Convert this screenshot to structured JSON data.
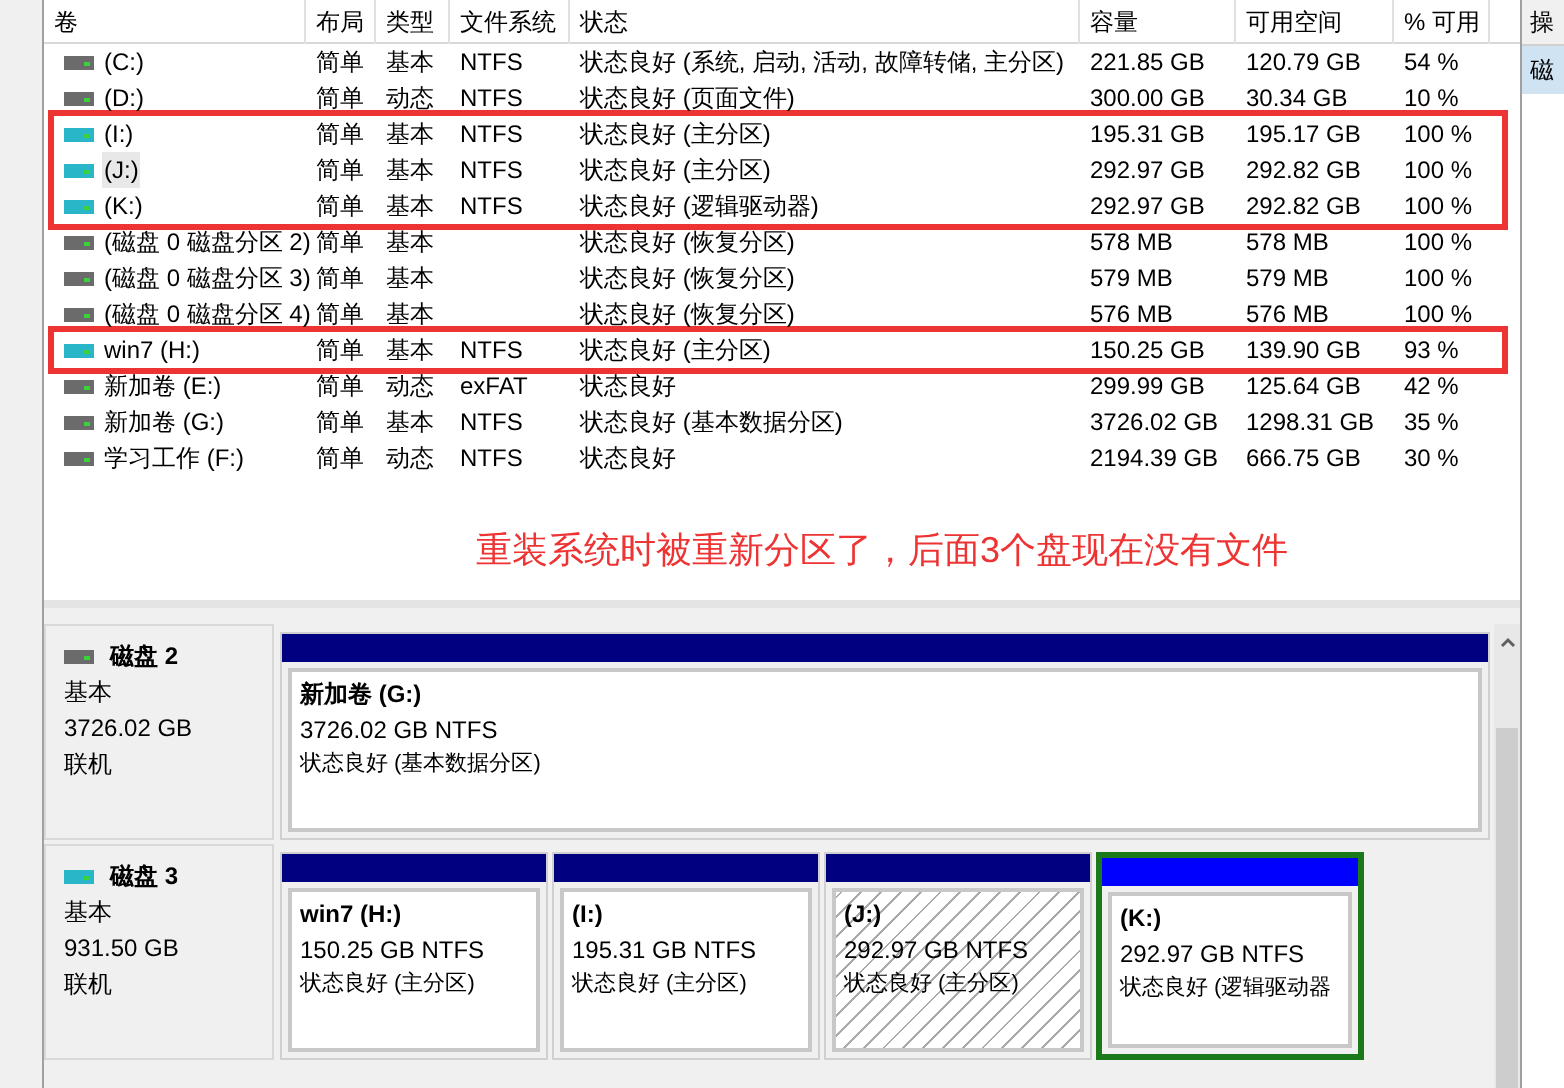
{
  "table": {
    "columns": [
      "卷",
      "布局",
      "类型",
      "文件系统",
      "状态",
      "容量",
      "可用空间",
      "% 可用"
    ],
    "rows": [
      {
        "cells": [
          "(C:)",
          "简单",
          "基本",
          "NTFS",
          "状态良好 (系统, 启动, 活动, 故障转储, 主分区)",
          "221.85 GB",
          "120.79 GB",
          "54 %"
        ],
        "color": "#6b6b6b",
        "highlighted": false,
        "selected": false
      },
      {
        "cells": [
          "(D:)",
          "简单",
          "动态",
          "NTFS",
          "状态良好 (页面文件)",
          "300.00 GB",
          "30.34 GB",
          "10 %"
        ],
        "color": "#6b6b6b",
        "highlighted": false,
        "selected": false
      },
      {
        "cells": [
          "(I:)",
          "简单",
          "基本",
          "NTFS",
          "状态良好 (主分区)",
          "195.31 GB",
          "195.17 GB",
          "100 %"
        ],
        "color": "#29b6c8",
        "highlighted": true,
        "selected": false
      },
      {
        "cells": [
          "(J:)",
          "简单",
          "基本",
          "NTFS",
          "状态良好 (主分区)",
          "292.97 GB",
          "292.82 GB",
          "100 %"
        ],
        "color": "#29b6c8",
        "highlighted": true,
        "selected": true
      },
      {
        "cells": [
          "(K:)",
          "简单",
          "基本",
          "NTFS",
          "状态良好 (逻辑驱动器)",
          "292.97 GB",
          "292.82 GB",
          "100 %"
        ],
        "color": "#29b6c8",
        "highlighted": true,
        "selected": false
      },
      {
        "cells": [
          "(磁盘 0 磁盘分区 2)",
          "简单",
          "基本",
          "",
          "状态良好 (恢复分区)",
          "578 MB",
          "578 MB",
          "100 %"
        ],
        "color": "#6b6b6b",
        "highlighted": false,
        "selected": false
      },
      {
        "cells": [
          "(磁盘 0 磁盘分区 3)",
          "简单",
          "基本",
          "",
          "状态良好 (恢复分区)",
          "579 MB",
          "579 MB",
          "100 %"
        ],
        "color": "#6b6b6b",
        "highlighted": false,
        "selected": false
      },
      {
        "cells": [
          "(磁盘 0 磁盘分区 4)",
          "简单",
          "基本",
          "",
          "状态良好 (恢复分区)",
          "576 MB",
          "576 MB",
          "100 %"
        ],
        "color": "#6b6b6b",
        "highlighted": false,
        "selected": false
      },
      {
        "cells": [
          "win7 (H:)",
          "简单",
          "基本",
          "NTFS",
          "状态良好 (主分区)",
          "150.25 GB",
          "139.90 GB",
          "93 %"
        ],
        "color": "#29b6c8",
        "highlighted": true,
        "selected": false
      },
      {
        "cells": [
          "新加卷 (E:)",
          "简单",
          "动态",
          "exFAT",
          "状态良好",
          "299.99 GB",
          "125.64 GB",
          "42 %"
        ],
        "color": "#6b6b6b",
        "highlighted": false,
        "selected": false
      },
      {
        "cells": [
          "新加卷 (G:)",
          "简单",
          "基本",
          "NTFS",
          "状态良好 (基本数据分区)",
          "3726.02 GB",
          "1298.31 GB",
          "35 %"
        ],
        "color": "#6b6b6b",
        "highlighted": false,
        "selected": false
      },
      {
        "cells": [
          "学习工作 (F:)",
          "简单",
          "动态",
          "NTFS",
          "状态良好",
          "2194.39 GB",
          "666.75 GB",
          "30 %"
        ],
        "color": "#6b6b6b",
        "highlighted": false,
        "selected": false
      }
    ]
  },
  "annotation": "重装系统时被重新分区了，后面3个盘现在没有文件",
  "disks": [
    {
      "name": "磁盘 2",
      "type": "基本",
      "size": "3726.02 GB",
      "state": "联机",
      "color": "#6b6b6b",
      "partitions": [
        {
          "name": "新加卷  (G:)",
          "size": "3726.02 GB NTFS",
          "status": "状态良好 (基本数据分区)",
          "kind": "primary",
          "selected": false
        }
      ]
    },
    {
      "name": "磁盘 3",
      "type": "基本",
      "size": "931.50 GB",
      "state": "联机",
      "color": "#29b6c8",
      "partitions": [
        {
          "name": "win7  (H:)",
          "size": "150.25 GB NTFS",
          "status": "状态良好 (主分区)",
          "kind": "primary",
          "selected": false
        },
        {
          "name": "(I:)",
          "size": "195.31 GB NTFS",
          "status": "状态良好 (主分区)",
          "kind": "primary",
          "selected": false
        },
        {
          "name": "(J:)",
          "size": "292.97 GB NTFS",
          "status": "状态良好 (主分区)",
          "kind": "primary",
          "selected": true
        },
        {
          "name": "(K:)",
          "size": "292.97 GB NTFS",
          "status": "状态良好 (逻辑驱动器",
          "kind": "logical",
          "selected": false
        }
      ]
    }
  ],
  "side_pane": {
    "header": "操",
    "item": "磁"
  }
}
